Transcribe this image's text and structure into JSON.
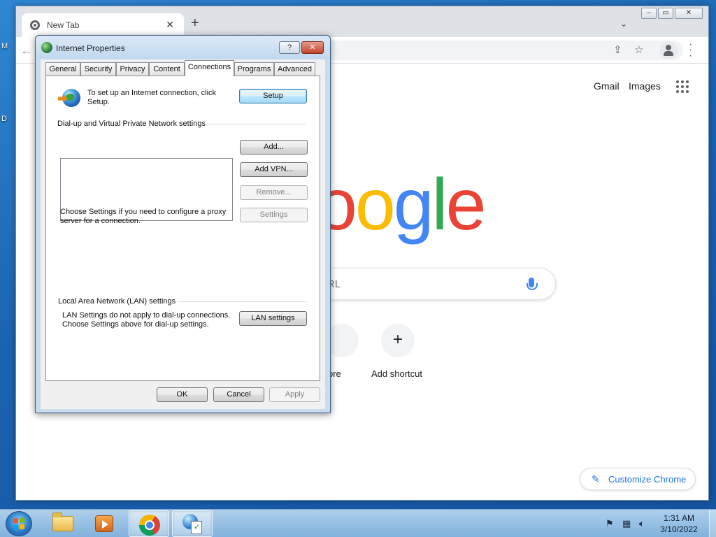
{
  "desktop": {
    "icon_labels": [
      "M",
      "D"
    ]
  },
  "chrome": {
    "tab": {
      "title": "New Tab"
    },
    "ntp": {
      "gmail": "Gmail",
      "images": "Images",
      "logo_letters": [
        "o",
        "o",
        "g",
        "l",
        "e"
      ],
      "search_placeholder_fragment": "RL",
      "shortcut_left_label": "ore",
      "add_shortcut_label": "Add shortcut",
      "add_shortcut_symbol": "+",
      "customize_label": "Customize Chrome"
    }
  },
  "dialog": {
    "title": "Internet Properties",
    "help_label": "?",
    "close_label": "✕",
    "tabs": [
      "General",
      "Security",
      "Privacy",
      "Content",
      "Connections",
      "Programs",
      "Advanced"
    ],
    "active_tab": "Connections",
    "setup_text": "To set up an Internet connection, click Setup.",
    "setup_button": "Setup",
    "dialup_group_label": "Dial-up and Virtual Private Network settings",
    "buttons": {
      "add": "Add...",
      "add_vpn": "Add VPN...",
      "remove": "Remove...",
      "settings": "Settings",
      "lan_settings": "LAN settings"
    },
    "proxy_text": "Choose Settings if you need to configure a proxy server for a connection.",
    "lan_group_label": "Local Area Network (LAN) settings",
    "lan_text": "LAN Settings do not apply to dial-up connections. Choose Settings above for dial-up settings.",
    "footer": {
      "ok": "OK",
      "cancel": "Cancel",
      "apply": "Apply"
    }
  },
  "taskbar": {
    "apps": [
      "start",
      "windows-explorer",
      "media-player",
      "google-chrome",
      "internet-properties"
    ],
    "active_apps": [
      "google-chrome",
      "internet-properties"
    ],
    "tray_icons": [
      "action-center-icon",
      "network-icon",
      "volume-icon"
    ],
    "clock": {
      "time": "1:31 AM",
      "date": "3/10/2022"
    }
  },
  "colors": {
    "google_blue": "#4285F4",
    "google_red": "#EA4335",
    "google_yellow": "#FBBC05",
    "google_green": "#34A853",
    "chrome_link_blue": "#1a73e8",
    "win7_desktop": "#1b63b0"
  }
}
